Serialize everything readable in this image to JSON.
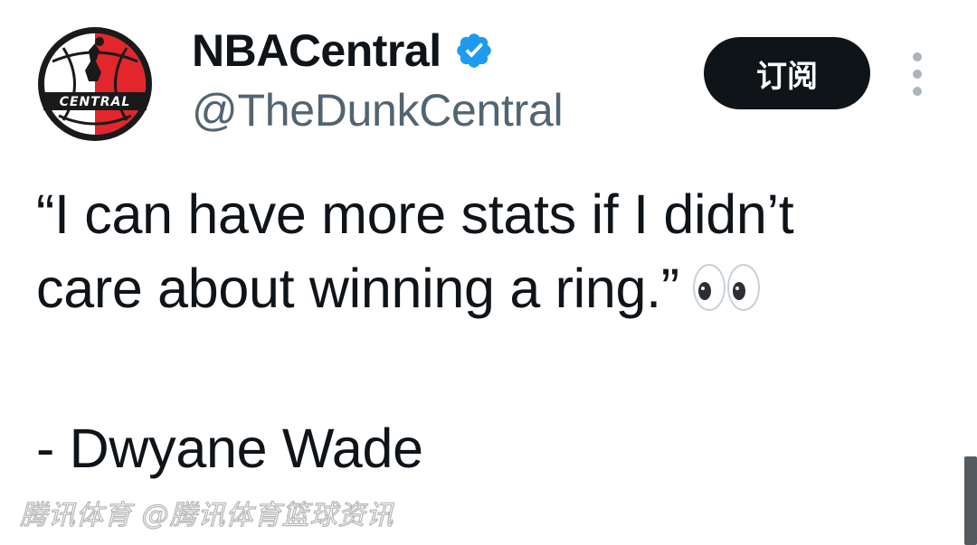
{
  "header": {
    "display_name": "NBACentral",
    "handle": "@TheDunkCentral",
    "subscribe_label": "订阅",
    "avatar_text": "CENTRAL"
  },
  "tweet": {
    "line1": "“I can have more stats if I didn’t",
    "line2": "care about winning a ring.”",
    "emoji": "eyes-emoji",
    "attribution": "- Dwyane Wade"
  },
  "watermark": "腾讯体育 @腾讯体育篮球资讯",
  "colors": {
    "text": "#0f1419",
    "handle": "#536471",
    "verified": "#1d9bf0",
    "button_bg": "#0f1419",
    "avatar_red": "#e2262b"
  }
}
